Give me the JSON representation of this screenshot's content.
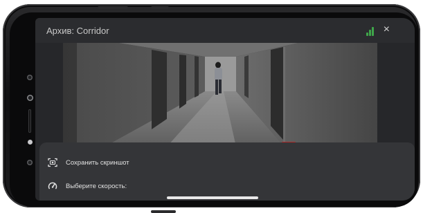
{
  "header": {
    "title": "Архив: Corridor",
    "signal_icon": "signal-bars-icon",
    "signal_color": "#3fa64a",
    "close_label": "×"
  },
  "menu": {
    "items": [
      {
        "label": "Сохранить скриншот",
        "icon": "screenshot-icon"
      },
      {
        "label": "Выберите скорость:",
        "icon": "speedometer-icon"
      }
    ]
  },
  "colors": {
    "sheet": "#343538",
    "topbar": "#2b2c2f",
    "recording_marker": "#b22b2b"
  }
}
